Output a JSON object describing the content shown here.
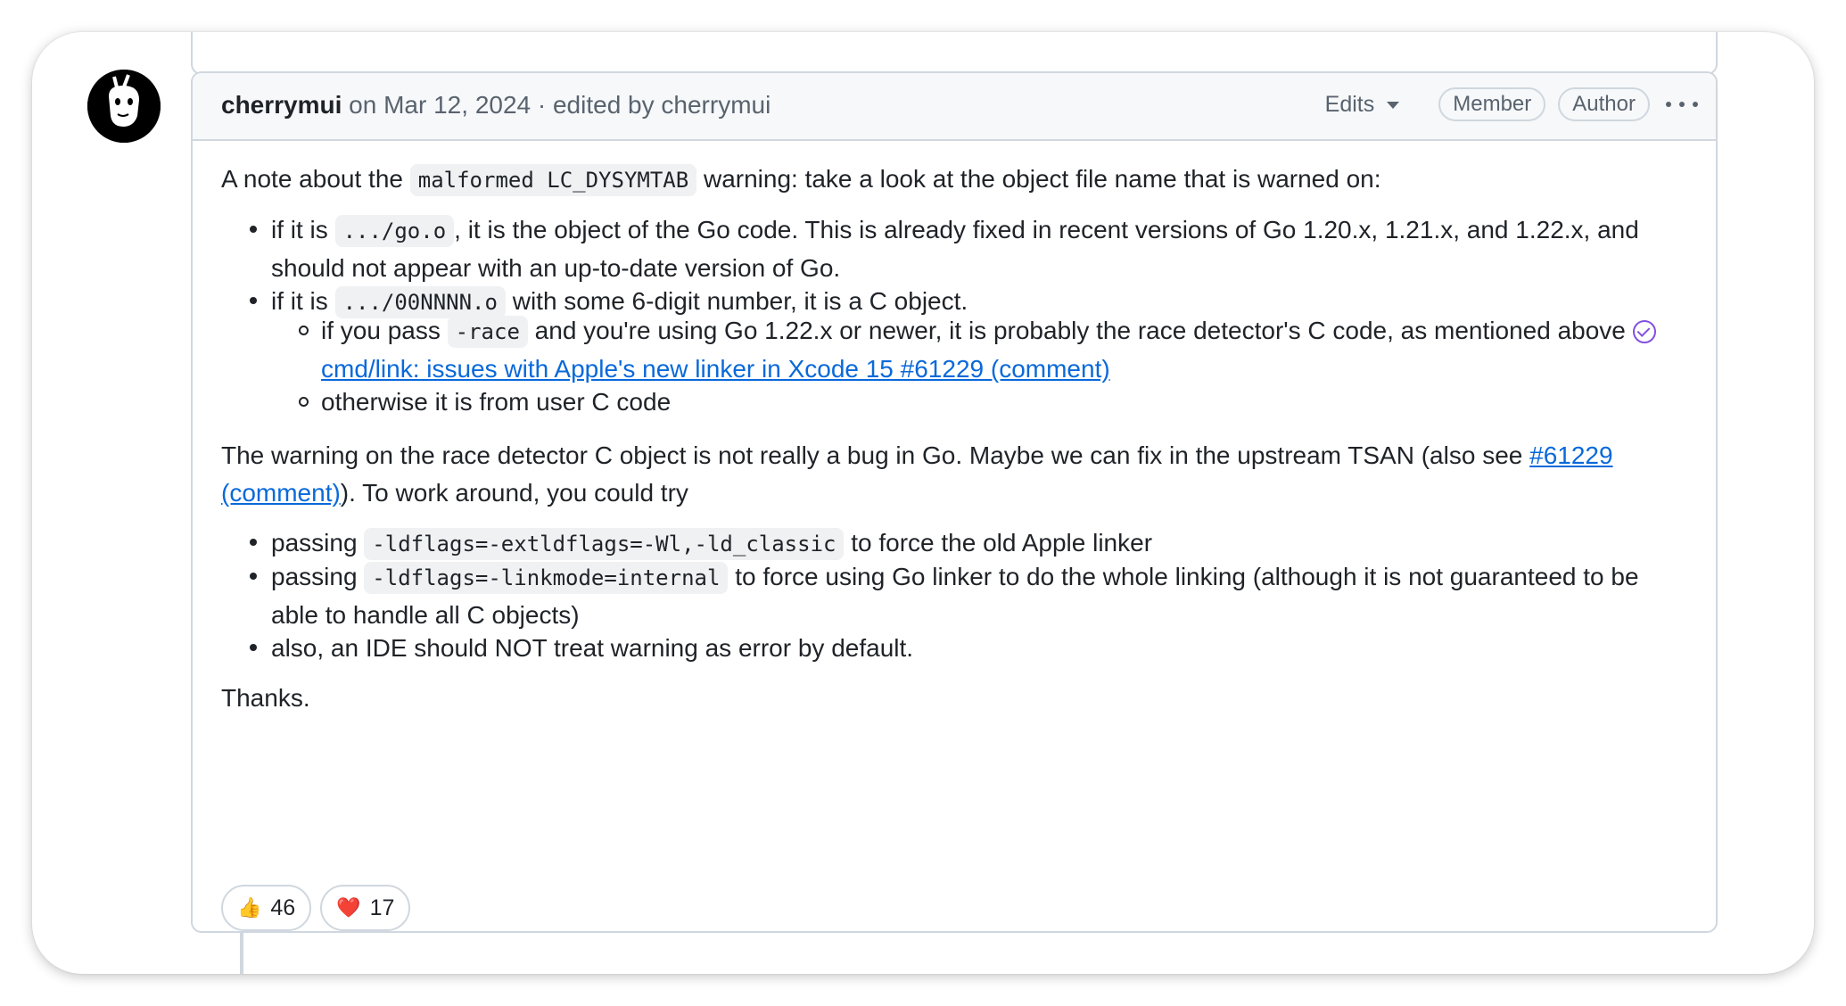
{
  "comment": {
    "author": "cherrymui",
    "meta": " on Mar 12, 2024 · edited by cherrymui",
    "edits_label": "Edits",
    "badges": [
      "Member",
      "Author"
    ]
  },
  "body": {
    "p1_text1": "A note about the ",
    "p1_code": "malformed LC_DYSYMTAB",
    "p1_text2": " warning: take a look at the object file name that is warned on:",
    "li1_text1": "if it is ",
    "li1_code": ".../go.o",
    "li1_text2": ", it is the object of the Go code. This is already fixed in recent versions of Go 1.20.x, 1.21.x, and 1.22.x, and should not appear with an up-to-date version of Go.",
    "li2_text1": "if it is ",
    "li2_code": ".../00NNNN.o",
    "li2_text2": " with some 6-digit number, it is a C object.",
    "sub1_text1": "if you pass ",
    "sub1_code": "-race",
    "sub1_text2": " and you're using Go 1.22.x or newer, it is probably the race detector's C code, as mentioned above ",
    "sub1_link": "cmd/link: issues with Apple's new linker in Xcode 15 #61229 (comment)",
    "sub2_text": "otherwise it is from user C code",
    "p2_text1": "The warning on the race detector C object is not really a bug in Go. Maybe we can fix in the upstream TSAN (also see ",
    "p2_link": "#61229 (comment)",
    "p2_text2": "). To work around, you could try",
    "li3_text1": "passing ",
    "li3_code": "-ldflags=-extldflags=-Wl,-ld_classic",
    "li3_text2": " to force the old Apple linker",
    "li4_text1": "passing ",
    "li4_code": "-ldflags=-linkmode=internal",
    "li4_text2": " to force using Go linker to do the whole linking (although it is not guaranteed to be able to handle all C objects)",
    "li5_text": "also, an IDE should NOT treat warning as error by default.",
    "thanks": "Thanks."
  },
  "reactions": [
    {
      "emoji": "👍",
      "count": "46"
    },
    {
      "emoji": "❤️",
      "count": "17"
    }
  ],
  "icons": [
    "avatar",
    "issue-closed-icon",
    "caret-down-icon",
    "kebab-icon"
  ]
}
